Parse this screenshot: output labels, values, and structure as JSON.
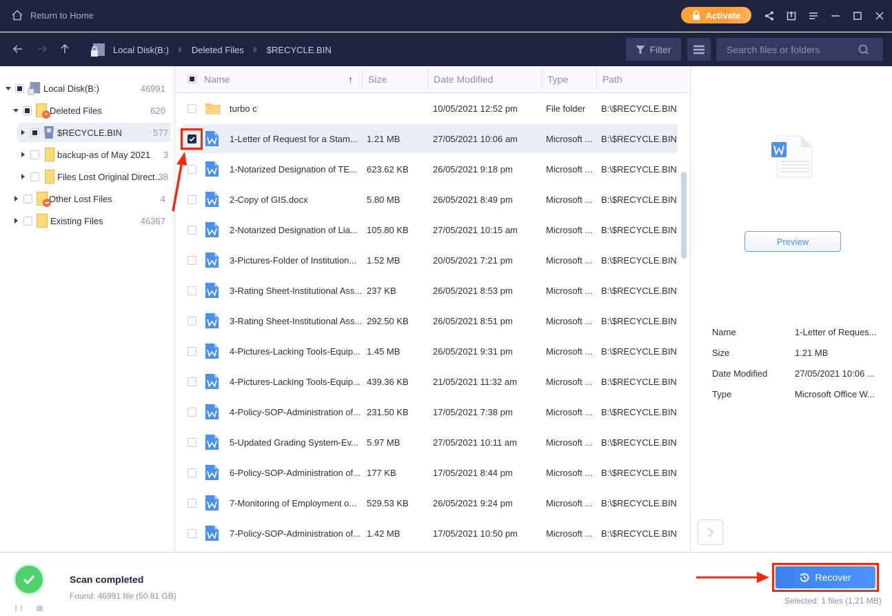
{
  "titlebar": {
    "home_label": "Return to Home",
    "activate_label": "Activate",
    "icons": [
      "share-icon",
      "feedback-icon",
      "menu-icon",
      "minimize-icon",
      "maximize-icon",
      "close-icon"
    ]
  },
  "navbar": {
    "breadcrumb": [
      "Local Disk(B:)",
      "Deleted Files",
      "$RECYCLE.BIN"
    ],
    "filter_label": "Filter",
    "search_placeholder": "Search files or folders"
  },
  "tree": [
    {
      "label": "Local Disk(B:)",
      "count": "46991",
      "level": 0,
      "expanded": true,
      "check": "partial",
      "icon": "disk"
    },
    {
      "label": "Deleted Files",
      "count": "620",
      "level": 1,
      "expanded": true,
      "check": "partial",
      "icon": "folder-deleted"
    },
    {
      "label": "$RECYCLE.BIN",
      "count": "577",
      "level": 2,
      "expanded": false,
      "check": "partial",
      "icon": "recycle-bin",
      "selected": true
    },
    {
      "label": "backup-as of May 2021",
      "count": "3",
      "level": 2,
      "expanded": false,
      "check": "none",
      "icon": "folder"
    },
    {
      "label": "Files Lost Original Direct...",
      "count": "38",
      "level": 2,
      "expanded": false,
      "check": "none",
      "icon": "folder"
    },
    {
      "label": "Other Lost Files",
      "count": "4",
      "level": 1,
      "expanded": false,
      "check": "none",
      "icon": "folder-lost"
    },
    {
      "label": "Existing Files",
      "count": "46367",
      "level": 1,
      "expanded": false,
      "check": "none",
      "icon": "folder"
    }
  ],
  "table": {
    "columns": [
      "Name",
      "Size",
      "Date Modified",
      "Type",
      "Path"
    ],
    "sort_indicator": "↑",
    "rows": [
      {
        "name": "turbo c",
        "size": "",
        "date": "10/05/2021 12:52 pm",
        "type": "File folder",
        "path": "B:\\$RECYCLE.BIN",
        "kind": "folder",
        "checked": false
      },
      {
        "name": "1-Letter of Request for a Stam...",
        "size": "1.21 MB",
        "date": "27/05/2021 10:06 am",
        "type": "Microsoft ...",
        "path": "B:\\$RECYCLE.BIN",
        "kind": "word",
        "checked": true
      },
      {
        "name": "1-Notarized Designation of TE...",
        "size": "623.62 KB",
        "date": "26/05/2021 9:18 pm",
        "type": "Microsoft ...",
        "path": "B:\\$RECYCLE.BIN",
        "kind": "word",
        "checked": false
      },
      {
        "name": "2-Copy of GIS.docx",
        "size": "5.80 MB",
        "date": "26/05/2021 8:49 pm",
        "type": "Microsoft ...",
        "path": "B:\\$RECYCLE.BIN",
        "kind": "word",
        "checked": false
      },
      {
        "name": "2-Notarized Designation of Lia...",
        "size": "105.80 KB",
        "date": "27/05/2021 10:15 am",
        "type": "Microsoft ...",
        "path": "B:\\$RECYCLE.BIN",
        "kind": "word",
        "checked": false
      },
      {
        "name": "3-Pictures-Folder of Institution...",
        "size": "1.52 MB",
        "date": "20/05/2021 7:21 pm",
        "type": "Microsoft ...",
        "path": "B:\\$RECYCLE.BIN",
        "kind": "word",
        "checked": false
      },
      {
        "name": "3-Rating Sheet-Institutional Ass...",
        "size": "237 KB",
        "date": "26/05/2021 8:53 pm",
        "type": "Microsoft ...",
        "path": "B:\\$RECYCLE.BIN",
        "kind": "word",
        "checked": false
      },
      {
        "name": "3-Rating Sheet-Institutional Ass...",
        "size": "292.50 KB",
        "date": "26/05/2021 8:51 pm",
        "type": "Microsoft ...",
        "path": "B:\\$RECYCLE.BIN",
        "kind": "word",
        "checked": false
      },
      {
        "name": "4-Pictures-Lacking Tools-Equip...",
        "size": "1.45 MB",
        "date": "26/05/2021 9:31 pm",
        "type": "Microsoft ...",
        "path": "B:\\$RECYCLE.BIN",
        "kind": "word",
        "checked": false
      },
      {
        "name": "4-Pictures-Lacking Tools-Equip...",
        "size": "439.36 KB",
        "date": "21/05/2021 11:32 am",
        "type": "Microsoft ...",
        "path": "B:\\$RECYCLE.BIN",
        "kind": "word",
        "checked": false
      },
      {
        "name": "4-Policy-SOP-Administration of...",
        "size": "231.50 KB",
        "date": "17/05/2021 7:38 pm",
        "type": "Microsoft ...",
        "path": "B:\\$RECYCLE.BIN",
        "kind": "word",
        "checked": false
      },
      {
        "name": "5-Updated Grading System-Ev...",
        "size": "5.97 MB",
        "date": "27/05/2021 10:11 am",
        "type": "Microsoft ...",
        "path": "B:\\$RECYCLE.BIN",
        "kind": "word",
        "checked": false
      },
      {
        "name": "6-Policy-SOP-Administration of...",
        "size": "177 KB",
        "date": "17/05/2021 8:44 pm",
        "type": "Microsoft ...",
        "path": "B:\\$RECYCLE.BIN",
        "kind": "word",
        "checked": false
      },
      {
        "name": "7-Monitoring of Employment o...",
        "size": "529.53 KB",
        "date": "26/05/2021 9:24 pm",
        "type": "Microsoft ...",
        "path": "B:\\$RECYCLE.BIN",
        "kind": "word",
        "checked": false
      },
      {
        "name": "7-Policy-SOP-Administration of...",
        "size": "1.42 MB",
        "date": "17/05/2021 10:50 pm",
        "type": "Microsoft ...",
        "path": "B:\\$RECYCLE.BIN",
        "kind": "word",
        "checked": false
      }
    ]
  },
  "detail": {
    "preview_label": "Preview",
    "info": [
      {
        "label": "Name",
        "value": "1-Letter of Reques..."
      },
      {
        "label": "Size",
        "value": "1.21 MB"
      },
      {
        "label": "Date Modified",
        "value": "27/05/2021 10:06 ..."
      },
      {
        "label": "Type",
        "value": "Microsoft Office W..."
      }
    ]
  },
  "bottom": {
    "status_title": "Scan completed",
    "status_sub": "Found: 46991 file (50.81 GB)",
    "recover_label": "Recover",
    "selected_text": "Selected: 1 files (1.21 MB)"
  },
  "colors": {
    "titlebar_bg": "#1f2440",
    "accent_orange": "#ff9f35",
    "recover_blue": "#3b82f0",
    "annotation_red": "#f22a12",
    "success_green": "#4fd26b"
  }
}
